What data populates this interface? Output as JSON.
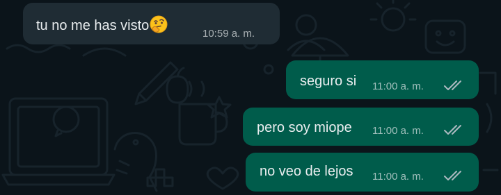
{
  "chat": {
    "messages": [
      {
        "direction": "incoming",
        "text": "tu no me has visto",
        "emoji": "thinking-face",
        "time": "10:59 a. m."
      },
      {
        "direction": "outgoing",
        "text": "seguro si",
        "time": "11:00 a. m.",
        "status": "delivered"
      },
      {
        "direction": "outgoing",
        "text": "pero soy miope",
        "time": "11:00 a. m.",
        "status": "delivered"
      },
      {
        "direction": "outgoing",
        "text": "no veo de lejos",
        "time": "11:00 a. m.",
        "status": "delivered"
      }
    ]
  },
  "colors": {
    "background": "#0b141a",
    "incoming_bubble": "#1f2c34",
    "outgoing_bubble": "#005c4b",
    "text": "#e9edef",
    "ticks": "#aebac1"
  }
}
